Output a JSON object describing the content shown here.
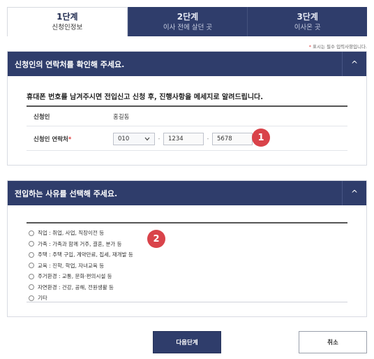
{
  "steps": [
    {
      "num": "1단계",
      "name": "신청인정보"
    },
    {
      "num": "2단계",
      "name": "이사 전에 살던 곳"
    },
    {
      "num": "3단계",
      "name": "이사온 곳"
    }
  ],
  "required_note": {
    "star": "*",
    "text": " 표시는 필수 입력사항입니다."
  },
  "contact_section": {
    "title": "신청인의 연락처를 확인해 주세요.",
    "toggle": "^",
    "intro": "휴대폰 번호를 남겨주시면 전입신고 신청 후, 진행사항을 메세지로 알려드립니다.",
    "name_label": "신청인",
    "name_value": "홍길동",
    "phone_label": "신청인 연락처",
    "phone_required": "*",
    "phone_prefix": "010",
    "phone_dash": "-",
    "phone_mid": "1234",
    "phone_last": "5678",
    "badge": "1"
  },
  "reason_section": {
    "title": "전입하는 사유를 선택해 주세요.",
    "toggle": "^",
    "badge": "2",
    "options": [
      "직업 : 취업, 사업, 직장이전 등",
      "가족 : 가족과 함께 거주, 결혼, 분가 등",
      "주택 : 주택 구입, 계약만료, 집세, 재개발 등",
      "교육 : 진학, 학업, 자녀교육 등",
      "주거환경 : 교통, 문화·편의시설 등",
      "자연환경 : 건강, 공해, 전원생활 등",
      "기타"
    ]
  },
  "buttons": {
    "next": "다음단계",
    "cancel": "취소"
  }
}
